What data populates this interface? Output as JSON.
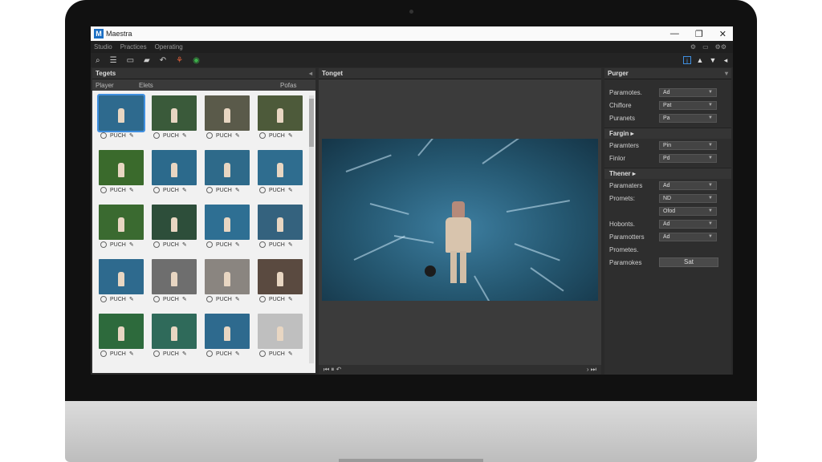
{
  "app": {
    "title": "Maestra",
    "logo": "M"
  },
  "window": {
    "minimize": "—",
    "maximize": "❐",
    "close": "✕"
  },
  "menu": {
    "items": [
      "Studio",
      "Practices",
      "Operating"
    ]
  },
  "toolbar": {
    "right_icons": [
      "info-icon",
      "warning-icon",
      "filter-icon",
      "expand-icon"
    ]
  },
  "left_panel": {
    "title": "Tegets",
    "columns": [
      "Player",
      "Elets",
      "Pofas"
    ]
  },
  "thumbnails": [
    {
      "caption": "PUCH",
      "bg": "#2e6a8e",
      "selected": true
    },
    {
      "caption": "PUCH",
      "bg": "#3a5a3a"
    },
    {
      "caption": "PUCH",
      "bg": "#5a5a4a"
    },
    {
      "caption": "PUCH",
      "bg": "#4d5a3a"
    },
    {
      "caption": "PUCH",
      "bg": "#3a6a2c"
    },
    {
      "caption": "PUCH",
      "bg": "#2c6a8c"
    },
    {
      "caption": "PUCH",
      "bg": "#2e6a8a"
    },
    {
      "caption": "PUCH",
      "bg": "#2f6d8f"
    },
    {
      "caption": "PUCH",
      "bg": "#3a6a30"
    },
    {
      "caption": "PUCH",
      "bg": "#2d4e3a"
    },
    {
      "caption": "PUCH",
      "bg": "#2e6f93"
    },
    {
      "caption": "PUCH",
      "bg": "#34627e"
    },
    {
      "caption": "PUCH",
      "bg": "#2e6a8e"
    },
    {
      "caption": "PUCH",
      "bg": "#6e6e6e"
    },
    {
      "caption": "PUCH",
      "bg": "#8a8580"
    },
    {
      "caption": "PUCH",
      "bg": "#5a4a40"
    },
    {
      "caption": "PUCH",
      "bg": "#2d6a3c"
    },
    {
      "caption": "PUCH",
      "bg": "#2f6a5a"
    },
    {
      "caption": "PUCH",
      "bg": "#2e6a8e"
    },
    {
      "caption": "PUCH",
      "bg": "#bfbfbf"
    }
  ],
  "center": {
    "title": "Tonget"
  },
  "right_panel": {
    "title": "Purger",
    "section1": [
      {
        "label": "Paramotes.",
        "value": "Ad"
      },
      {
        "label": "Chiflore",
        "value": "Pat"
      },
      {
        "label": "Puranets",
        "value": "Pa"
      }
    ],
    "section2_title": "Fargin",
    "section2": [
      {
        "label": "Paramters",
        "value": "Pin"
      },
      {
        "label": "Finlor",
        "value": "Pd"
      }
    ],
    "section3_title": "Thener",
    "section3": [
      {
        "label": "Paramaters",
        "value": "Ad"
      },
      {
        "label": "Promets:",
        "value": "ND"
      },
      {
        "label": "",
        "value": "Ofod"
      },
      {
        "label": "Hobonts.",
        "value": "Ad"
      },
      {
        "label": "Paramotters",
        "value": "Ad"
      },
      {
        "label": "Prometes.",
        "value": ""
      }
    ],
    "button_row_label": "Paramokes",
    "button_label": "Sat"
  }
}
